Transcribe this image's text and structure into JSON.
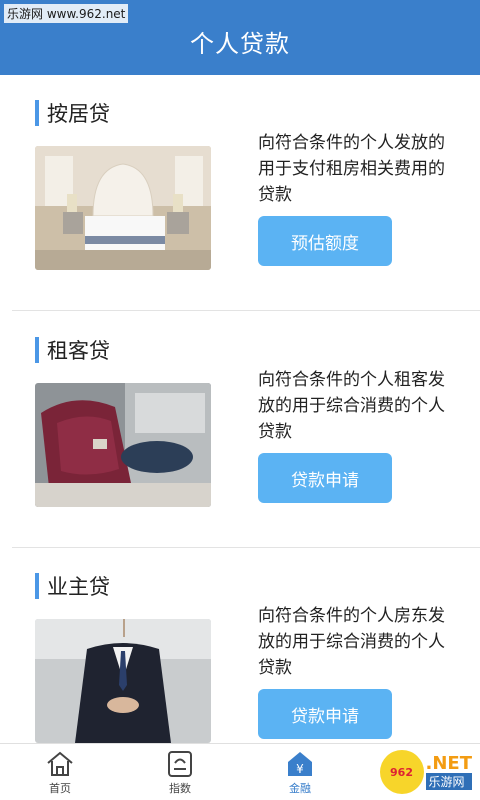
{
  "watermark_top": "乐游网 www.962.net",
  "header": {
    "title": "个人贷款"
  },
  "sections": [
    {
      "title": "按居贷",
      "description": "向符合条件的个人发放的用于支付租房相关费用的贷款",
      "button": "预估额度"
    },
    {
      "title": "租客贷",
      "description": "向符合条件的个人租客发放的用于综合消费的个人贷款",
      "button": "贷款申请"
    },
    {
      "title": "业主贷",
      "description": "向符合条件的个人房东发放的用于综合消费的个人贷款",
      "button": "贷款申请"
    }
  ],
  "tabbar": {
    "items": [
      {
        "label": "首页",
        "icon": "home-icon"
      },
      {
        "label": "指数",
        "icon": "index-icon"
      },
      {
        "label": "金融",
        "icon": "finance-icon"
      }
    ],
    "active_color": "#3a7fcb"
  },
  "watermark_bottom": {
    "brand": "962",
    "net": ".NET",
    "sub": "乐游网"
  }
}
